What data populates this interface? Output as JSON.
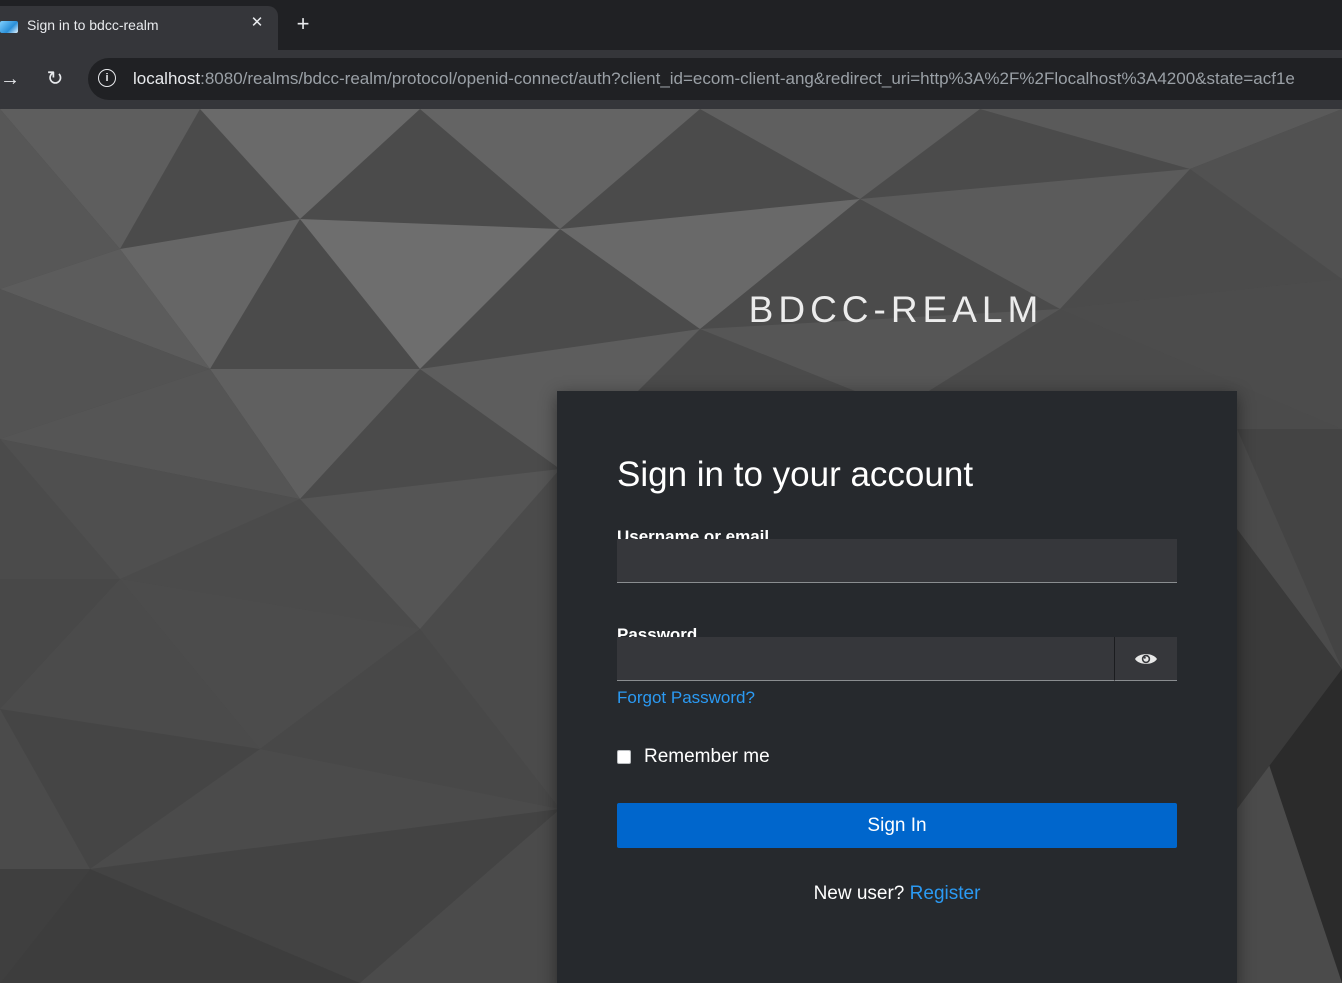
{
  "browser": {
    "tab_title": "Sign in to bdcc-realm",
    "tab_favicon": "keycloak-favicon",
    "close_tab_glyph": "✕",
    "new_tab_glyph": "+",
    "forward_glyph": "→",
    "reload_glyph": "↻",
    "site_info_glyph": "i",
    "url_host": "localhost",
    "url_rest": ":8080/realms/bdcc-realm/protocol/openid-connect/auth?client_id=ecom-client-ang&redirect_uri=http%3A%2F%2Flocalhost%3A4200&state=acf1e"
  },
  "page": {
    "realm_title": "BDCC-REALM",
    "heading": "Sign in to your account",
    "username_label": "Username or email",
    "username_value": "",
    "password_label": "Password",
    "password_value": "",
    "show_password_icon": "eye-icon",
    "forgot_password": "Forgot Password?",
    "remember_me": "Remember me",
    "remember_me_checked": false,
    "sign_in_button": "Sign In",
    "new_user_text": "New user?",
    "register_link": "Register"
  },
  "colors": {
    "card_background": "#26292d",
    "primary_button": "#0066cc",
    "link": "#2b9af3",
    "input_background": "#36373b"
  }
}
